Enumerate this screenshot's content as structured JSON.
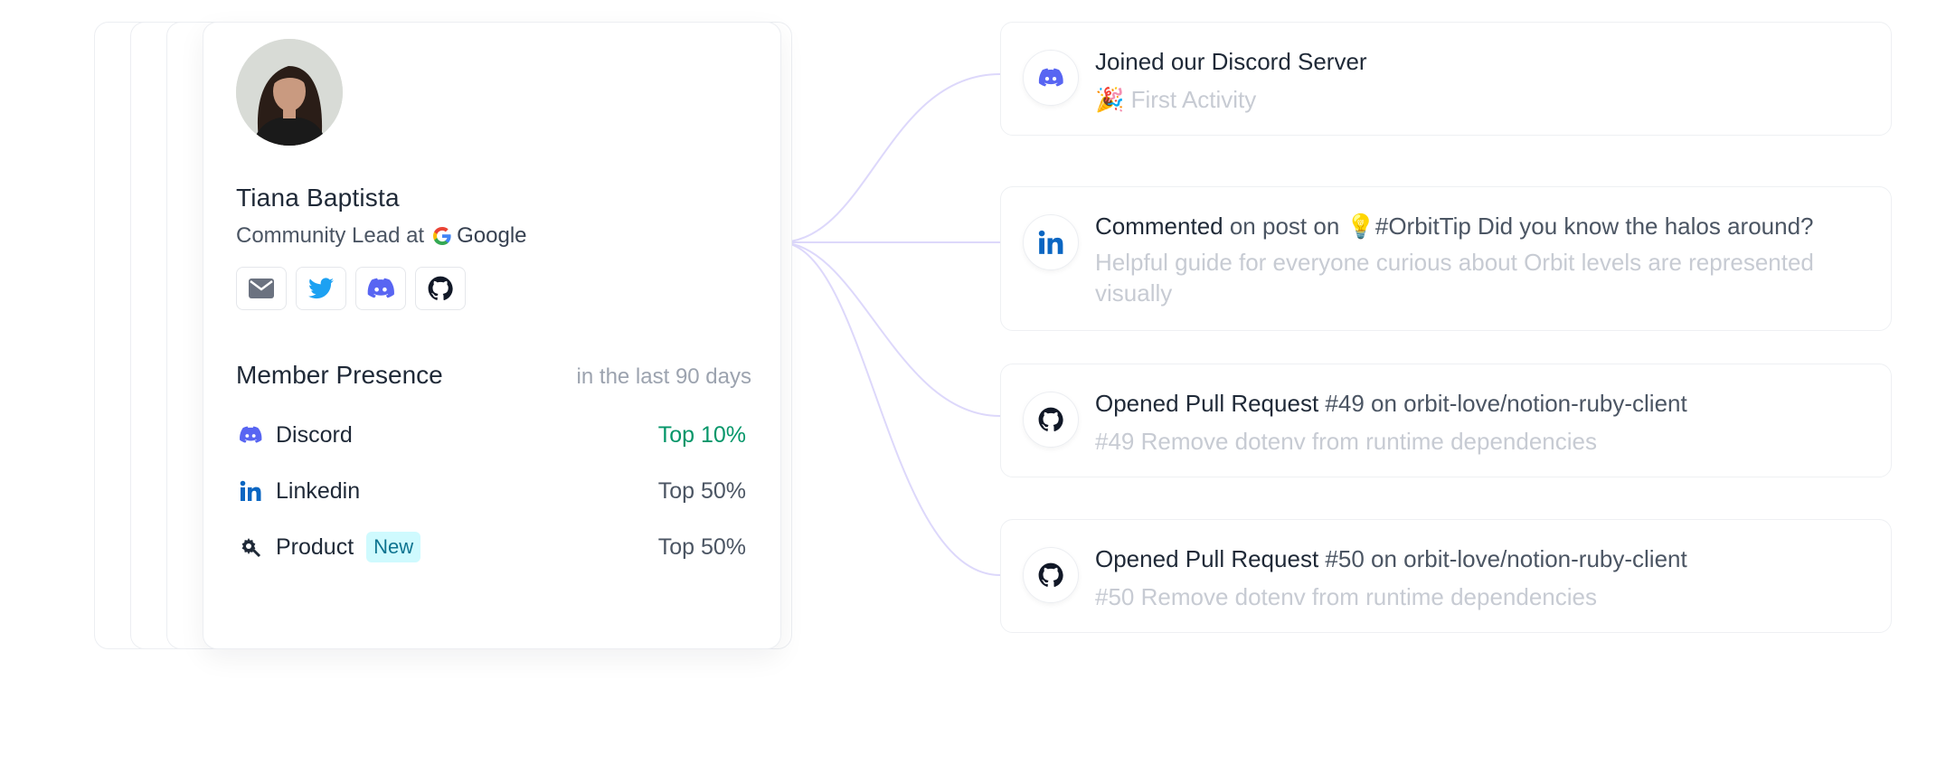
{
  "profile": {
    "name": "Tiana Baptista",
    "role_prefix": "Community Lead at",
    "company": "Google",
    "socials": [
      "email-icon",
      "twitter-icon",
      "discord-icon",
      "github-icon"
    ]
  },
  "presence": {
    "title": "Member Presence",
    "subtitle": "in the last 90 days",
    "rows": [
      {
        "label": "Discord",
        "rank": "Top 10%",
        "icon": "discord-icon",
        "rank_color": "#059669"
      },
      {
        "label": "Linkedin",
        "rank": "Top 50%",
        "icon": "linkedin-icon"
      },
      {
        "label": "Product",
        "rank": "Top 50%",
        "icon": "product-icon",
        "badge": "New"
      }
    ]
  },
  "activities": [
    {
      "icon": "discord-icon",
      "title_strong": "Joined our Discord Server",
      "title_rest": "",
      "emoji": "🎉",
      "subtitle": "First Activity"
    },
    {
      "icon": "linkedin-icon",
      "title_strong": "Commented",
      "title_rest": " on post on 💡#OrbitTip Did you know the halos around?",
      "subtitle": "Helpful guide for everyone curious about Orbit levels are represented visually"
    },
    {
      "icon": "github-icon",
      "title_strong": "Opened Pull Request",
      "title_rest": " #49 on orbit-love/notion-ruby-client",
      "subtitle": "#49 Remove dotenv from runtime dependencies"
    },
    {
      "icon": "github-icon",
      "title_strong": "Opened Pull Request",
      "title_rest": " #50 on orbit-love/notion-ruby-client",
      "subtitle": "#50 Remove dotenv from runtime dependencies"
    }
  ],
  "colors": {
    "discord": "#5865F2",
    "linkedin": "#0A66C2",
    "twitter": "#1DA1F2",
    "green": "#059669",
    "connector": "#ddd8fb"
  }
}
